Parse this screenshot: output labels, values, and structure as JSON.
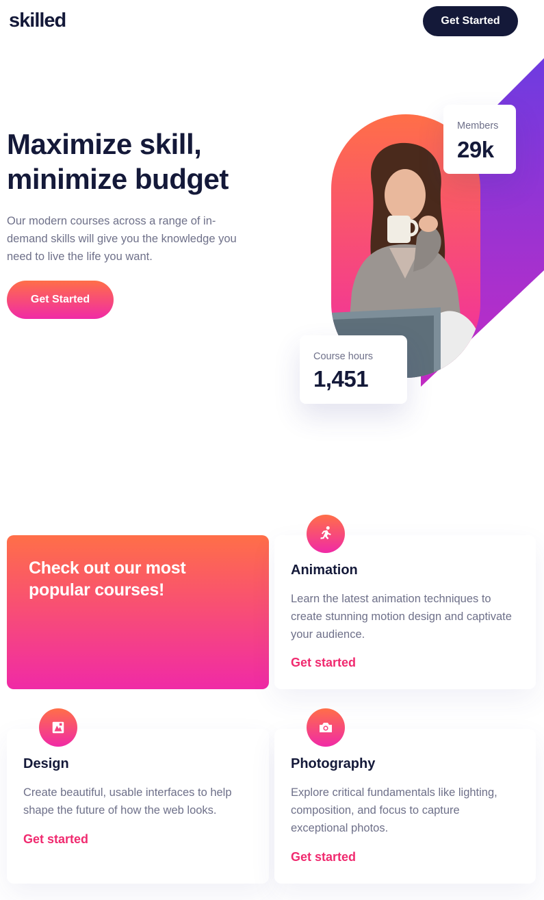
{
  "header": {
    "logo": "skilled",
    "cta_label": "Get Started"
  },
  "hero": {
    "title": "Maximize skill, minimize budget",
    "description": "Our modern courses across a range of in-demand skills will give you the knowledge you need to live the life you want.",
    "cta_label": "Get Started",
    "stats": {
      "members": {
        "label": "Members",
        "value": "29k"
      },
      "course_hours": {
        "label": "Course hours",
        "value": "1,451"
      }
    }
  },
  "courses": {
    "promo_title": "Check out our most popular courses!",
    "items": [
      {
        "icon": "running-person-icon",
        "title": "Animation",
        "description": "Learn the latest animation techniques to create stunning motion design and captivate your audience.",
        "link_label": "Get started"
      },
      {
        "icon": "design-icon",
        "title": "Design",
        "description": "Create beautiful, usable interfaces to help shape the future of how the web looks.",
        "link_label": "Get started"
      },
      {
        "icon": "camera-icon",
        "title": "Photography",
        "description": "Explore critical fundamentals like lighting, composition, and focus to capture exceptional photos.",
        "link_label": "Get started"
      }
    ]
  },
  "colors": {
    "navy": "#141939",
    "gradient_start": "#ff6f48",
    "gradient_end": "#f02aa6",
    "purple": "#6e3be0",
    "link": "#f02a6f",
    "body_text": "#6e7089"
  }
}
